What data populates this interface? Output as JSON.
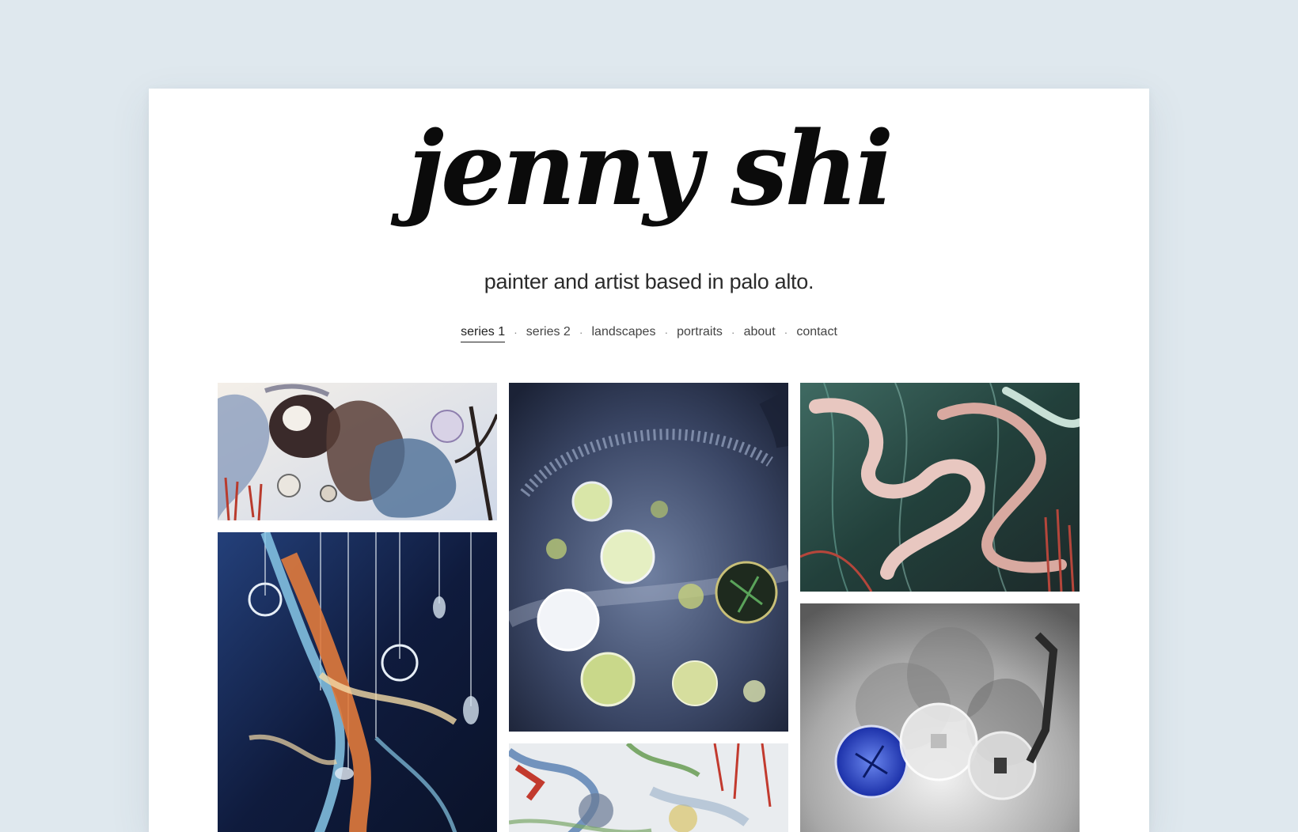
{
  "header": {
    "title": "jenny shi",
    "tagline": "painter and artist based in palo alto."
  },
  "nav": {
    "items": [
      {
        "label": "series 1",
        "active": true
      },
      {
        "label": "series 2",
        "active": false
      },
      {
        "label": "landscapes",
        "active": false
      },
      {
        "label": "portraits",
        "active": false
      },
      {
        "label": "about",
        "active": false
      },
      {
        "label": "contact",
        "active": false
      }
    ],
    "separator": "·"
  },
  "gallery": {
    "artworks": [
      {
        "name": "artwork-abstract-organic-forms",
        "palette": [
          "#f3efe9",
          "#3a2a2a",
          "#5a7fa8",
          "#b93b2d",
          "#d8d2e6"
        ]
      },
      {
        "name": "artwork-petri-dish-galaxy",
        "palette": [
          "#1b2236",
          "#6f7fa0",
          "#c9d88a",
          "#e9edf2",
          "#2d3a5c"
        ]
      },
      {
        "name": "artwork-pink-coral-strands",
        "palette": [
          "#2f4a44",
          "#e8c7c0",
          "#6aa69a",
          "#b5463b",
          "#1d2a2a"
        ]
      },
      {
        "name": "artwork-hanging-rings-blue",
        "palette": [
          "#0f1b3d",
          "#e07a3c",
          "#87c7e6",
          "#f2d9a6",
          "#24407a"
        ]
      },
      {
        "name": "artwork-glass-vessels-monochrome",
        "palette": [
          "#8a8a8a",
          "#e9e9e9",
          "#2340c0",
          "#4a4a4a",
          "#cfcfcf"
        ]
      },
      {
        "name": "artwork-colorful-abstract-partial",
        "palette": [
          "#e9ecef",
          "#c23a2e",
          "#3f6ea8",
          "#7ba86a",
          "#d9c56a"
        ]
      }
    ]
  },
  "colors": {
    "background": "#dfe8ee",
    "card": "#ffffff",
    "text": "#222222"
  }
}
